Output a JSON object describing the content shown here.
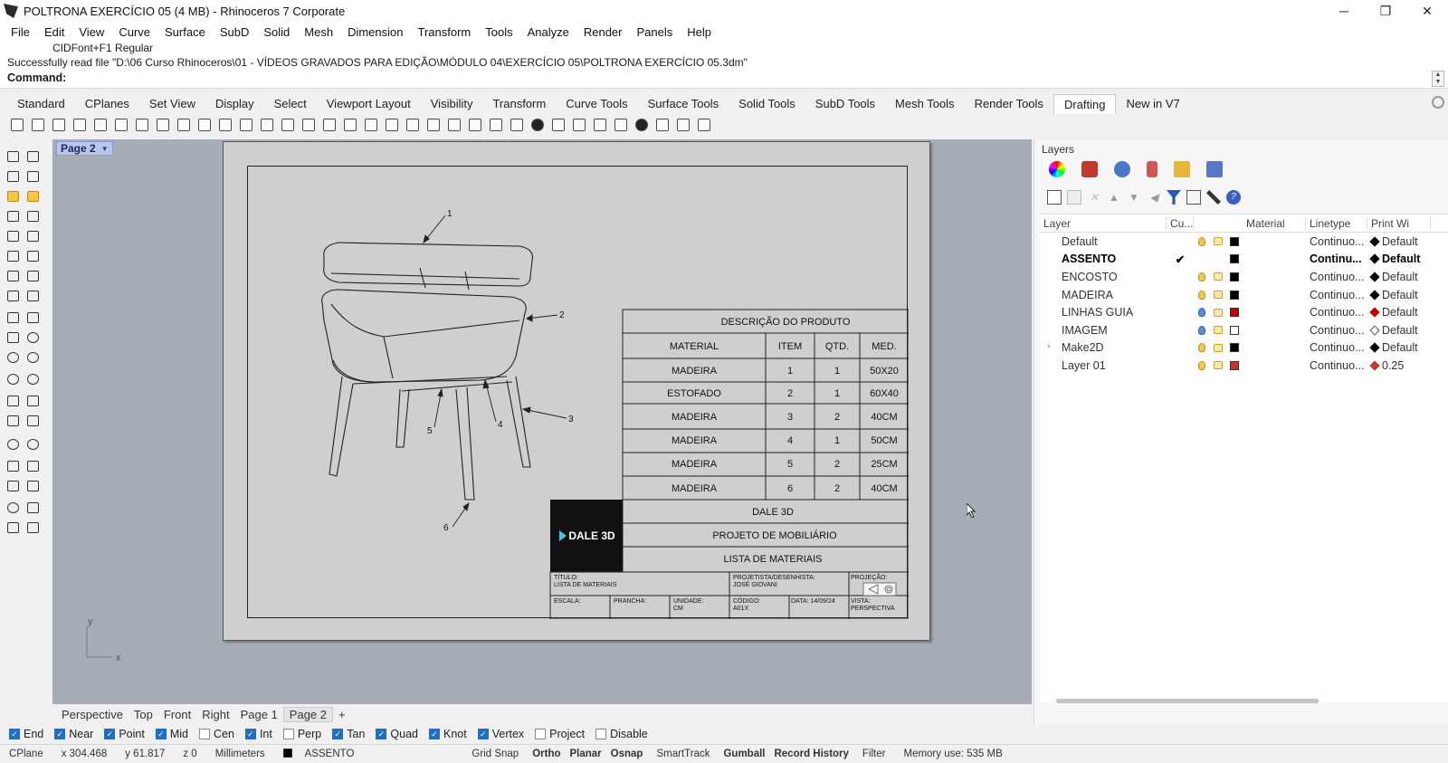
{
  "window": {
    "title": "POLTRONA EXERCÍCIO 05 (4 MB) - Rhinoceros 7 Corporate"
  },
  "menu": [
    "File",
    "Edit",
    "View",
    "Curve",
    "Surface",
    "SubD",
    "Solid",
    "Mesh",
    "Dimension",
    "Transform",
    "Tools",
    "Analyze",
    "Render",
    "Panels",
    "Help"
  ],
  "command": {
    "history_1": "CIDFont+F1 Regular",
    "history_2": "Successfully read file \"D:\\06 Curso Rhinoceros\\01 - VÍDEOS GRAVADOS PARA EDIÇÃO\\MÓDULO 04\\EXERCÍCIO 05\\POLTRONA EXERCÍCIO 05.3dm\"",
    "prompt": "Command:",
    "value": ""
  },
  "toolbar_tabs": [
    "Standard",
    "CPlanes",
    "Set View",
    "Display",
    "Select",
    "Viewport Layout",
    "Visibility",
    "Transform",
    "Curve Tools",
    "Surface Tools",
    "Solid Tools",
    "SubD Tools",
    "Mesh Tools",
    "Render Tools",
    "Drafting",
    "New in V7"
  ],
  "active_toolbar_tab": "Drafting",
  "viewport": {
    "page_tab": "Page 2",
    "axis_x": "x",
    "axis_y": "y"
  },
  "drawing": {
    "callouts": [
      "1",
      "2",
      "3",
      "4",
      "5",
      "6"
    ],
    "table_title": "DESCRIÇÃO DO PRODUTO",
    "headers": [
      "MATERIAL",
      "ITEM",
      "QTD.",
      "MED."
    ],
    "rows": [
      [
        "MADEIRA",
        "1",
        "1",
        "50X20"
      ],
      [
        "ESTOFADO",
        "2",
        "1",
        "60X40"
      ],
      [
        "MADEIRA",
        "3",
        "2",
        "40CM"
      ],
      [
        "MADEIRA",
        "4",
        "1",
        "50CM"
      ],
      [
        "MADEIRA",
        "5",
        "2",
        "25CM"
      ],
      [
        "MADEIRA",
        "6",
        "2",
        "40CM"
      ]
    ],
    "logo_text": "DALE 3D",
    "company": "DALE 3D",
    "project": "PROJETO DE MOBILIÁRIO",
    "list": "LISTA DE MATERIAIS",
    "titulo_label": "TÍTULO:",
    "titulo_value": "LISTA DE MATERIAIS",
    "projetista_label": "PROJETISTA/DESENHISTA:",
    "projetista_value": "JOSÉ GIOVANI",
    "projecao_label": "PROJEÇÃO:",
    "escala_label": "ESCALA:",
    "prancha_label": "PRANCHA:",
    "unidade_label": "UNIDADE:",
    "unidade_value": "CM",
    "codigo_label": "CÓDIGO:",
    "codigo_value": "A01X",
    "data_label": "DATA: 14/09/24",
    "vista_label": "VISTA:",
    "vista_value": "PERSPECTIVA"
  },
  "view_tabs": [
    "Perspective",
    "Top",
    "Front",
    "Right",
    "Page 1",
    "Page 2"
  ],
  "active_view_tab": "Page 2",
  "layers_panel": {
    "title": "Layers",
    "columns": [
      "Layer",
      "Cu...",
      "Material",
      "Linetype",
      "Print Wi"
    ],
    "rows": [
      {
        "name": "Default",
        "current": "",
        "bulb": "yellow",
        "color": "#000000",
        "linetype": "Continuo...",
        "print": "Default",
        "diamond": "solid"
      },
      {
        "name": "ASSENTO",
        "current": "✔",
        "bulb": "",
        "color": "#000000",
        "linetype": "Continu...",
        "print": "Default",
        "diamond": "solid"
      },
      {
        "name": "ENCOSTO",
        "current": "",
        "bulb": "yellow",
        "color": "#000000",
        "linetype": "Continuo...",
        "print": "Default",
        "diamond": "solid"
      },
      {
        "name": "MADEIRA",
        "current": "",
        "bulb": "yellow",
        "color": "#000000",
        "linetype": "Continuo...",
        "print": "Default",
        "diamond": "solid"
      },
      {
        "name": "LINHAS GUIA",
        "current": "",
        "bulb": "blue",
        "color": "#c00000",
        "linetype": "Continuo...",
        "print": "Default",
        "diamond": "red"
      },
      {
        "name": "IMAGEM",
        "current": "",
        "bulb": "blue",
        "color": "#ffffff",
        "linetype": "Continuo...",
        "print": "Default",
        "diamond": "hollow"
      },
      {
        "name": "Make2D",
        "current": "",
        "bulb": "yellow",
        "color": "#000000",
        "linetype": "Continuo...",
        "print": "Default",
        "diamond": "solid"
      },
      {
        "name": "Layer 01",
        "current": "",
        "bulb": "yellow",
        "color": "#c0392b",
        "linetype": "Continuo...",
        "print": "0.25",
        "diamond": "red"
      }
    ]
  },
  "osnaps": [
    {
      "label": "End",
      "on": true
    },
    {
      "label": "Near",
      "on": true
    },
    {
      "label": "Point",
      "on": true
    },
    {
      "label": "Mid",
      "on": true
    },
    {
      "label": "Cen",
      "on": false
    },
    {
      "label": "Int",
      "on": true
    },
    {
      "label": "Perp",
      "on": false
    },
    {
      "label": "Tan",
      "on": true
    },
    {
      "label": "Quad",
      "on": true
    },
    {
      "label": "Knot",
      "on": true
    },
    {
      "label": "Vertex",
      "on": true
    },
    {
      "label": "Project",
      "on": false
    },
    {
      "label": "Disable",
      "on": false
    }
  ],
  "status": {
    "cplane": "CPlane",
    "x": "x 304.468",
    "y": "y 61.817",
    "z": "z 0",
    "units": "Millimeters",
    "layer": "ASSENTO",
    "grid_snap": "Grid Snap",
    "ortho": "Ortho",
    "planar": "Planar",
    "osnap": "Osnap",
    "smarttrack": "SmartTrack",
    "gumball": "Gumball",
    "record_history": "Record History",
    "filter": "Filter",
    "memory": "Memory use: 535 MB"
  }
}
